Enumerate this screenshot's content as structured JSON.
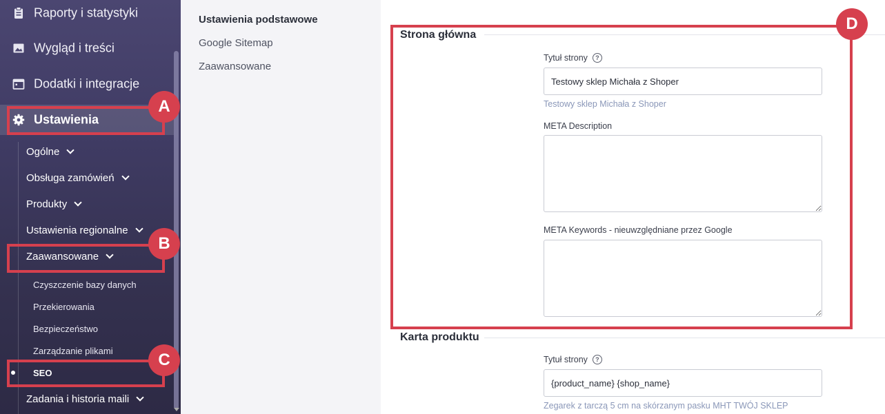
{
  "sidebar": {
    "top_items": [
      {
        "label": "Raporty i statystyki",
        "icon": "clipboard-icon"
      },
      {
        "label": "Wygląd i treści",
        "icon": "image-icon"
      },
      {
        "label": "Dodatki i integracje",
        "icon": "calendar-icon"
      },
      {
        "label": "Ustawienia",
        "icon": "gear-icon"
      }
    ],
    "sub_items": [
      {
        "label": "Ogólne"
      },
      {
        "label": "Obsługa zamówień"
      },
      {
        "label": "Produkty"
      },
      {
        "label": "Ustawienia regionalne"
      },
      {
        "label": "Zaawansowane"
      }
    ],
    "subsub_items": [
      {
        "label": "Czyszczenie bazy danych"
      },
      {
        "label": "Przekierowania"
      },
      {
        "label": "Bezpieczeństwo"
      },
      {
        "label": "Zarządzanie plikami"
      },
      {
        "label": "SEO"
      }
    ],
    "bottom_item": {
      "label": "Zadania i historia maili"
    }
  },
  "subnav": {
    "items": [
      {
        "label": "Ustawienia podstawowe"
      },
      {
        "label": "Google Sitemap"
      },
      {
        "label": "Zaawansowane"
      }
    ]
  },
  "main": {
    "home_section": {
      "title": "Strona główna",
      "page_title_label": "Tytuł strony",
      "page_title_value": "Testowy sklep Michała z Shoper",
      "page_title_hint": "Testowy sklep Michała z Shoper",
      "meta_description_label": "META Description",
      "meta_description_value": "",
      "meta_keywords_label": "META Keywords - nieuwzględniane przez Google",
      "meta_keywords_value": ""
    },
    "product_section": {
      "title": "Karta produktu",
      "page_title_label": "Tytuł strony",
      "page_title_value": "{product_name} {shop_name}",
      "page_title_hint": "Zegarek z tarczą 5 cm na skórzanym pasku MHT TWÓJ SKLEP"
    }
  },
  "callouts": {
    "a": "A",
    "b": "B",
    "c": "C",
    "d": "D",
    "color": "#d6404e"
  },
  "help_symbol": "?"
}
